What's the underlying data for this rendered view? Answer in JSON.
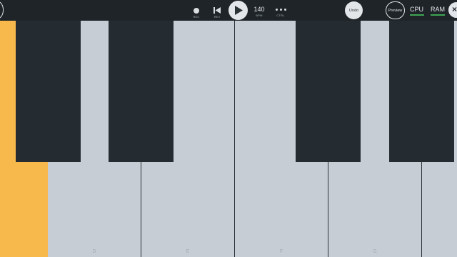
{
  "toolbar": {
    "rec_label": "REC",
    "rev_label": "REV",
    "bpm_value": "140",
    "bpm_label": "BPM",
    "ctrl_label": "CTRL",
    "undo_label": "Undo",
    "preview_label": "Preview",
    "cpu_label": "CPU",
    "ram_label": "RAM",
    "close_glyph": "×"
  },
  "keyboard": {
    "white_key_labels": [
      "",
      "D",
      "E",
      "F",
      "G"
    ],
    "pressed_key_color": "#f7b84c"
  },
  "colors": {
    "toolbar_bg": "#1e2428",
    "white_key": "#c6cdd5",
    "black_key": "#252c31",
    "meter_green": "#3ea552"
  },
  "icons": {
    "rec": "record-dot-icon",
    "rev": "skip-back-icon",
    "play": "play-icon",
    "ctrl": "more-dots-icon"
  }
}
